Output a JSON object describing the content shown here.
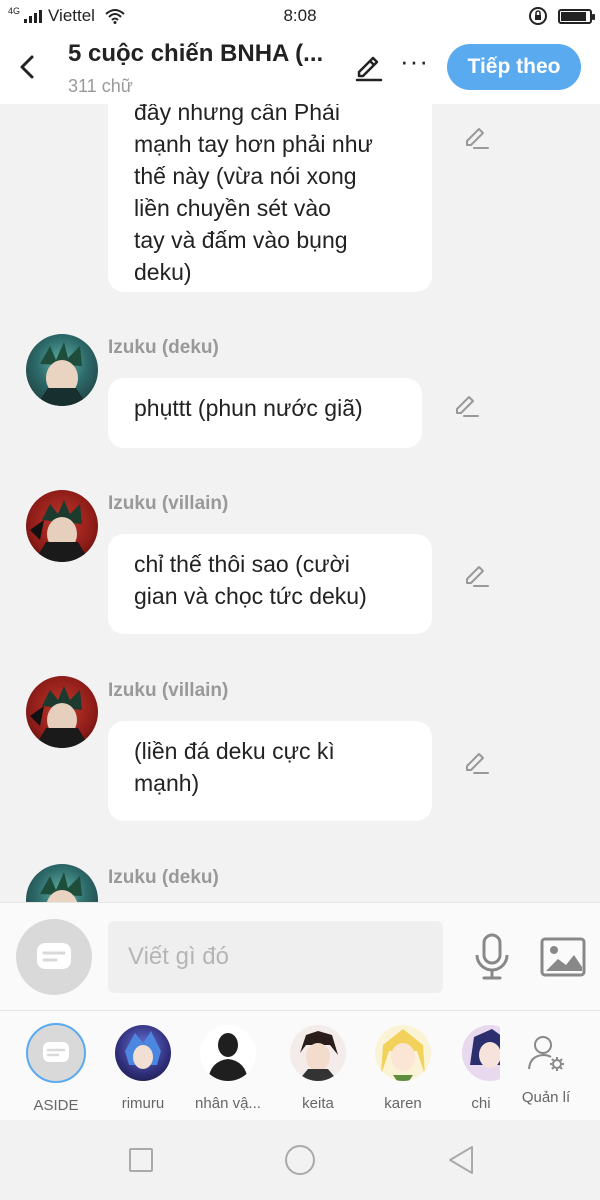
{
  "status_bar": {
    "network": "4G",
    "carrier": "Viettel",
    "time": "8:08",
    "battery_level": 0.9
  },
  "header": {
    "title": "5 cuộc chiến BNHA (...",
    "word_count": "311 chữ",
    "next_label": "Tiếp theo"
  },
  "messages": [
    {
      "id": "m1",
      "sender": "",
      "avatar": "",
      "lines": [
        "đây nhưng cần Phải",
        "mạnh tay hơn phải như",
        "thế này (vừa nói xong",
        "liền chuyền sét vào",
        "tay và đấm vào bụng",
        "deku)"
      ]
    },
    {
      "id": "m2",
      "sender": "Izuku (deku)",
      "avatar": "deku-avatar",
      "text": "phụttt (phun nước giã)"
    },
    {
      "id": "m3",
      "sender": "Izuku (villain)",
      "avatar": "villain-avatar",
      "lines": [
        "chỉ thế thôi sao (cười",
        "gian và chọc tức deku)"
      ]
    },
    {
      "id": "m4",
      "sender": "Izuku (villain)",
      "avatar": "villain-avatar",
      "lines": [
        "(liền đá deku cực kì",
        "mạnh)"
      ]
    },
    {
      "id": "m5",
      "sender": "Izuku (deku)",
      "avatar": "deku-avatar",
      "text": ""
    }
  ],
  "composer": {
    "placeholder": "Viết gì đó"
  },
  "characters": [
    {
      "label": "ASIDE",
      "selected": true
    },
    {
      "label": "rimuru"
    },
    {
      "label": "nhân vậ..."
    },
    {
      "label": "keita"
    },
    {
      "label": "karen"
    },
    {
      "label": "chi"
    }
  ],
  "manage_label": "Quản lí",
  "colors": {
    "accent": "#5aaaf0",
    "background": "#f2f2f2",
    "bubble": "#ffffff",
    "muted_text": "#999999"
  }
}
